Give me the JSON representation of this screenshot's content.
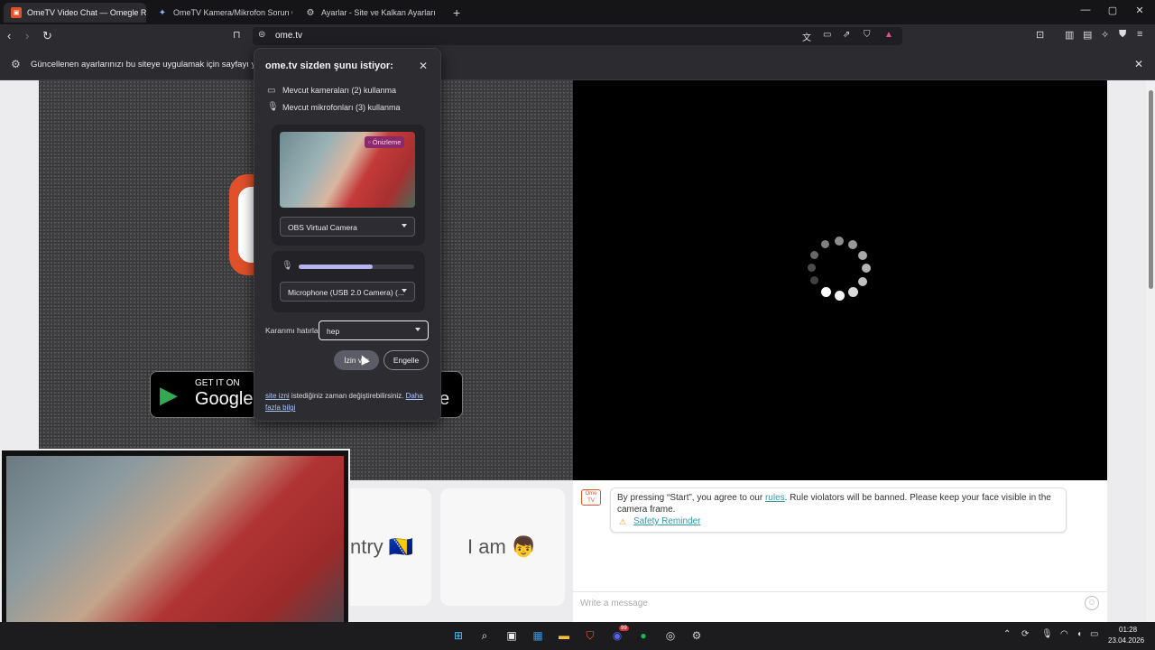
{
  "browser": {
    "tabs": [
      {
        "label": "OmeTV Video Chat — Omegle R",
        "icon": "ometv-icon",
        "active": true
      },
      {
        "label": "OmeTV Kamera/Mikrofon Sorun Gid",
        "icon": "sparkle-icon",
        "active": false
      },
      {
        "label": "Ayarlar - Site ve Kalkan Ayarları",
        "icon": "gear-icon",
        "active": false
      }
    ],
    "url": "ome.tv",
    "infobar_text": "Güncellenen ayarlarınızı bu siteye uygulamak için sayfayı yeniden"
  },
  "permission_popup": {
    "title": "ome.tv sizden şunu istiyor:",
    "camera_request": "Mevcut kameraları (2) kullanma",
    "mic_request": "Mevcut mikrofonları (3) kullanma",
    "preview_badge": "Önizleme",
    "camera_select": "OBS Virtual Camera",
    "mic_select": "Microphone (USB 2.0 Camera) (...",
    "mic_level": 0.64,
    "remember_label": "Kararımı hatırla",
    "remember_select": "hep",
    "allow_label": "İzin ver",
    "block_label": "Engelle",
    "footer_link1": "site izni",
    "footer_text": " istediğiniz zaman değiştirebilirsiniz. ",
    "footer_link2": "Daha fazla bilgi"
  },
  "page": {
    "store_get": "GET IT ON",
    "store_name": "Google",
    "store_apple_tail": "e",
    "card_country": "ntry 🇧🇦",
    "card_iam": "I am 👦",
    "chat_prefix": "By pressing “Start”, you agree to our ",
    "chat_rules": "rules",
    "chat_suffix": ". Rule violators will be banned. Please keep your face visible in the camera frame.",
    "safety_reminder": "Safety Reminder",
    "message_placeholder": "Write a message",
    "ome_avatar": "Ome TV"
  },
  "taskbar": {
    "time": "01:28",
    "date": "23.04.2026",
    "discord_badge": "99"
  },
  "colors": {
    "accent_orange": "#e0502a",
    "link_teal": "#2e9ba8",
    "mic_level": "#b6b4f0"
  }
}
